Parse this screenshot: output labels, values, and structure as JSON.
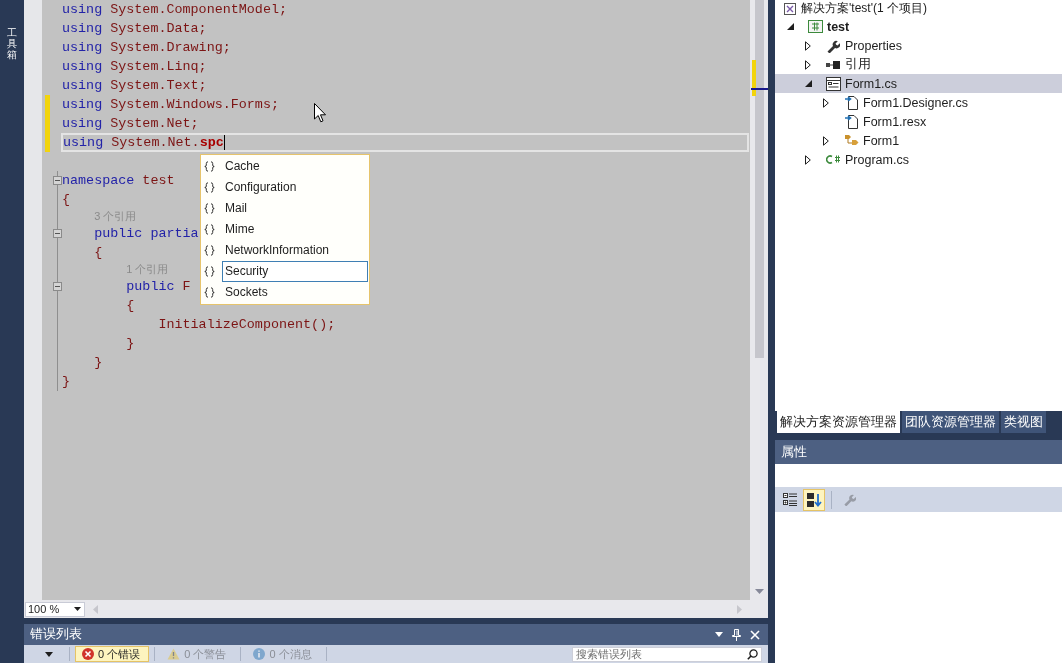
{
  "side_tabs": [
    {
      "label": "工具箱"
    }
  ],
  "editor": {
    "lines": [
      {
        "kind": "code",
        "changed": false,
        "current": false,
        "foldable": false,
        "tokens": [
          {
            "kind": "keyword",
            "text": "using"
          },
          {
            "kind": "plain",
            "text": " System.ComponentModel;"
          }
        ]
      },
      {
        "kind": "code",
        "changed": false,
        "current": false,
        "foldable": false,
        "tokens": [
          {
            "kind": "keyword",
            "text": "using"
          },
          {
            "kind": "plain",
            "text": " System.Data;"
          }
        ]
      },
      {
        "kind": "code",
        "changed": false,
        "current": false,
        "foldable": false,
        "tokens": [
          {
            "kind": "keyword",
            "text": "using"
          },
          {
            "kind": "plain",
            "text": " System.Drawing;"
          }
        ]
      },
      {
        "kind": "code",
        "changed": false,
        "current": false,
        "foldable": false,
        "tokens": [
          {
            "kind": "keyword",
            "text": "using"
          },
          {
            "kind": "plain",
            "text": " System.Linq;"
          }
        ]
      },
      {
        "kind": "code",
        "changed": false,
        "current": false,
        "foldable": false,
        "tokens": [
          {
            "kind": "keyword",
            "text": "using"
          },
          {
            "kind": "plain",
            "text": " System.Text;"
          }
        ]
      },
      {
        "kind": "code",
        "changed": true,
        "current": false,
        "foldable": false,
        "tokens": [
          {
            "kind": "keyword",
            "text": "using"
          },
          {
            "kind": "plain",
            "text": " System.Windows.Forms;"
          }
        ]
      },
      {
        "kind": "code",
        "changed": true,
        "current": false,
        "foldable": false,
        "tokens": [
          {
            "kind": "keyword",
            "text": "using"
          },
          {
            "kind": "plain",
            "text": " System.Net;"
          }
        ]
      },
      {
        "kind": "code",
        "changed": true,
        "current": true,
        "foldable": false,
        "tokens": [
          {
            "kind": "keyword",
            "text": "using"
          },
          {
            "kind": "plain",
            "text": " System.Net."
          },
          {
            "kind": "typed",
            "text": "spc"
          }
        ]
      },
      {
        "kind": "blank"
      },
      {
        "kind": "code",
        "changed": false,
        "current": false,
        "foldable": true,
        "tokens": [
          {
            "kind": "keyword",
            "text": "namespace"
          },
          {
            "kind": "plain",
            "text": " test"
          }
        ]
      },
      {
        "kind": "code",
        "changed": false,
        "current": false,
        "foldable": false,
        "tokens": [
          {
            "kind": "plain",
            "text": "{"
          }
        ]
      },
      {
        "kind": "codelens",
        "changed": false,
        "current": false,
        "foldable": false,
        "text": "3 个引用"
      },
      {
        "kind": "code",
        "changed": false,
        "current": false,
        "foldable": true,
        "tokens": [
          {
            "kind": "keyword",
            "text": "    public partia"
          }
        ]
      },
      {
        "kind": "code",
        "changed": false,
        "current": false,
        "foldable": false,
        "tokens": [
          {
            "kind": "plain",
            "text": "    {"
          }
        ]
      },
      {
        "kind": "codelens",
        "changed": false,
        "current": false,
        "foldable": false,
        "text": "1 个引用"
      },
      {
        "kind": "code",
        "changed": false,
        "current": false,
        "foldable": true,
        "tokens": [
          {
            "kind": "keyword",
            "text": "        public"
          },
          {
            "kind": "plain",
            "text": " F"
          }
        ]
      },
      {
        "kind": "code",
        "changed": false,
        "current": false,
        "foldable": false,
        "tokens": [
          {
            "kind": "plain",
            "text": "        {"
          }
        ]
      },
      {
        "kind": "code",
        "changed": false,
        "current": false,
        "foldable": false,
        "tokens": [
          {
            "kind": "plain",
            "text": "            InitializeComponent();"
          }
        ]
      },
      {
        "kind": "code",
        "changed": false,
        "current": false,
        "foldable": false,
        "tokens": [
          {
            "kind": "plain",
            "text": "        }"
          }
        ]
      },
      {
        "kind": "code",
        "changed": false,
        "current": false,
        "foldable": false,
        "tokens": [
          {
            "kind": "plain",
            "text": "    }"
          }
        ]
      },
      {
        "kind": "code",
        "changed": false,
        "current": false,
        "foldable": false,
        "tokens": [
          {
            "kind": "plain",
            "text": "}"
          }
        ]
      }
    ],
    "completion": {
      "items": [
        {
          "label": "Cache",
          "selected": false
        },
        {
          "label": "Configuration",
          "selected": false
        },
        {
          "label": "Mail",
          "selected": false
        },
        {
          "label": "Mime",
          "selected": false
        },
        {
          "label": "NetworkInformation",
          "selected": false
        },
        {
          "label": "Security",
          "selected": true
        },
        {
          "label": "Sockets",
          "selected": false
        }
      ]
    },
    "zoom": "100 %"
  },
  "solution_explorer": {
    "header": "解决方案'test'(1 个项目)",
    "items": [
      {
        "label": "test",
        "kind": "project",
        "expanded": true,
        "selected": false,
        "children": [
          {
            "label": "Properties",
            "kind": "properties",
            "expanded": false,
            "selected": false
          },
          {
            "label": "引用",
            "kind": "references",
            "expanded": false,
            "selected": false
          },
          {
            "label": "Form1.cs",
            "kind": "form",
            "expanded": true,
            "selected": true,
            "children": [
              {
                "label": "Form1.Designer.cs",
                "kind": "file",
                "expanded": false,
                "selected": false
              },
              {
                "label": "Form1.resx",
                "kind": "file",
                "selected": false
              },
              {
                "label": "Form1",
                "kind": "class",
                "expanded": false,
                "selected": false
              }
            ]
          },
          {
            "label": "Program.cs",
            "kind": "code-file",
            "expanded": false,
            "selected": false
          }
        ]
      }
    ]
  },
  "panel_tabs": [
    {
      "label": "解决方案资源管理器",
      "selected": true
    },
    {
      "label": "团队资源管理器",
      "selected": false
    },
    {
      "label": "类视图",
      "selected": false
    }
  ],
  "properties": {
    "title": "属性",
    "toolbar": [
      {
        "kind": "categorized",
        "pressed": false,
        "disabled": false
      },
      {
        "kind": "alphabetical",
        "pressed": true,
        "disabled": false
      },
      {
        "kind": "property-pages",
        "pressed": false,
        "disabled": true
      }
    ]
  },
  "error_list": {
    "title": "错误列表",
    "filters": [
      {
        "kind": "error",
        "label": "0 个错误",
        "selected": true
      },
      {
        "kind": "warning",
        "label": "0 个警告",
        "selected": false
      },
      {
        "kind": "message",
        "label": "0 个消息",
        "selected": false
      }
    ],
    "search": {
      "placeholder": "搜索错误列表"
    }
  }
}
